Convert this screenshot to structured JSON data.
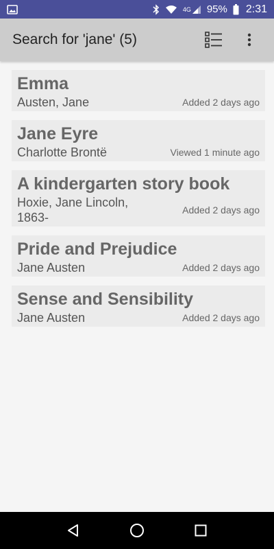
{
  "status_bar": {
    "network_label": "4G",
    "battery": "95%",
    "time": "2:31",
    "icons": [
      "image-icon",
      "bluetooth-icon",
      "wifi-icon",
      "cell-signal-icon",
      "battery-icon"
    ]
  },
  "app_bar": {
    "title": "Search for 'jane' (5)",
    "icons": [
      "list-view-icon",
      "more-vert-icon"
    ]
  },
  "results": [
    {
      "title": "Emma",
      "author": "Austen, Jane",
      "status": "Added 2 days ago"
    },
    {
      "title": "Jane Eyre",
      "author": "Charlotte Brontë",
      "status": "Viewed 1 minute ago"
    },
    {
      "title": "A kindergarten story book",
      "author": "Hoxie, Jane Lincoln, 1863-",
      "status": "Added 2 days ago"
    },
    {
      "title": "Pride and Prejudice",
      "author": "Jane Austen",
      "status": "Added 2 days ago"
    },
    {
      "title": "Sense and Sensibility",
      "author": "Jane Austen",
      "status": "Added 2 days ago"
    }
  ],
  "nav_bar": {
    "icons": [
      "back-icon",
      "home-icon",
      "recents-icon"
    ]
  },
  "colors": {
    "status_bar": "#4a4f99",
    "app_bar": "#cccccc",
    "card": "#ebebeb",
    "background": "#f5f5f5"
  }
}
